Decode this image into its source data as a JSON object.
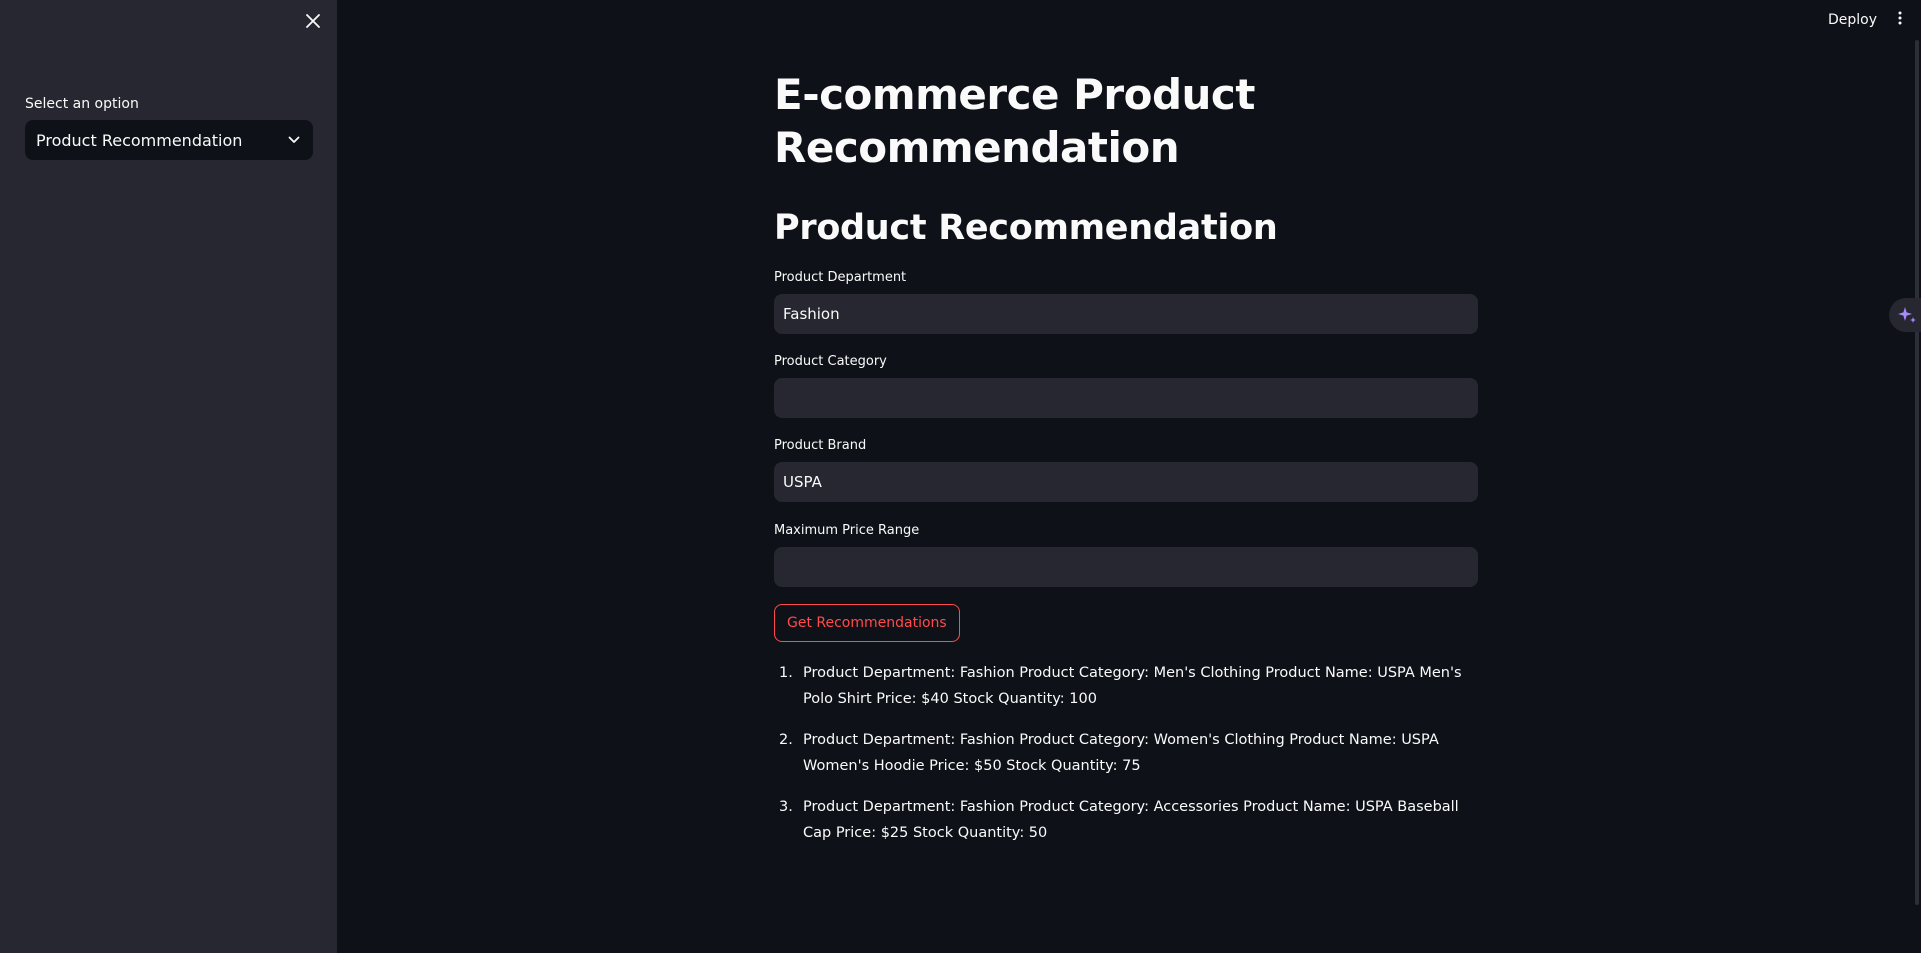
{
  "sidebar": {
    "select_label": "Select an option",
    "select_value": "Product Recommendation"
  },
  "header": {
    "deploy_label": "Deploy"
  },
  "main": {
    "title": "E-commerce Product Recommendation",
    "section_title": "Product Recommendation",
    "fields": {
      "department": {
        "label": "Product Department",
        "value": "Fashion"
      },
      "category": {
        "label": "Product Category",
        "value": ""
      },
      "brand": {
        "label": "Product Brand",
        "value": "USPA"
      },
      "max_price": {
        "label": "Maximum Price Range",
        "value": ""
      }
    },
    "button_label": "Get Recommendations",
    "results": [
      {
        "num": "1.",
        "text": "Product Department: Fashion Product Category: Men's Clothing Product Name: USPA Men's Polo Shirt Price: $40 Stock Quantity: 100"
      },
      {
        "num": "2.",
        "text": "Product Department: Fashion Product Category: Women's Clothing Product Name: USPA Women's Hoodie Price: $50 Stock Quantity: 75"
      },
      {
        "num": "3.",
        "text": "Product Department: Fashion Product Category: Accessories Product Name: USPA Baseball Cap Price: $25 Stock Quantity: 50"
      }
    ]
  },
  "colors": {
    "background": "#0e1117",
    "sidebar": "#262730",
    "input": "#262730",
    "accent": "#ff4b4b",
    "text": "#fafafa"
  }
}
